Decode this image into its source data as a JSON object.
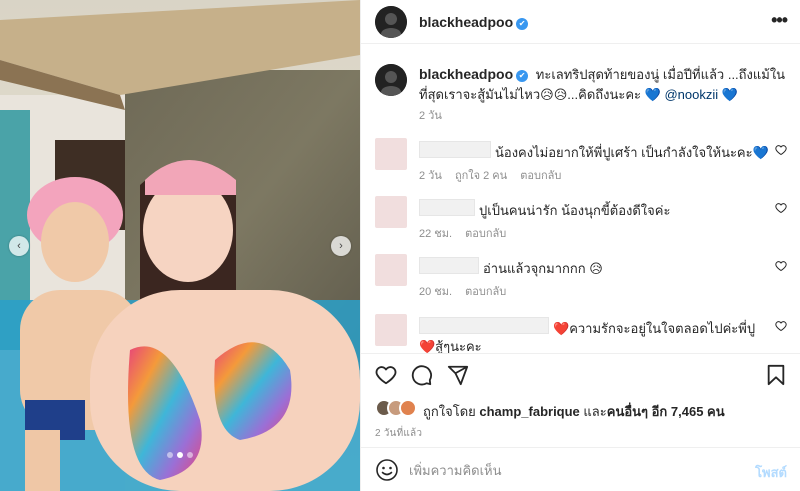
{
  "header": {
    "username": "blackheadpoo",
    "verified_mark": "✔",
    "more_icon": "more-horizontal-icon"
  },
  "caption": {
    "username": "blackheadpoo",
    "text": "ทะเลทริปสุดท้ายของนู่ เมื่อปีที่แล้ว ...ถึงแม้ในที่สุดเราจะสู้มันไม่ไหว😥😥...คิดถึงนะคะ",
    "heart1": "💙",
    "mention": "@nookzii",
    "heart2": "💙",
    "time": "2 วัน"
  },
  "comments": [
    {
      "text": "น้องคงไม่อยากให้พี่ปูเศร้า เป็นกำลังใจให้นะคะ💙",
      "time": "2 วัน",
      "likes": "ถูกใจ 2 คน",
      "reply": "ตอบกลับ"
    },
    {
      "text": "ปูเป็นคนน่ารัก น้องนุกขี้ต้องดีใจค่ะ",
      "time": "22 ชม.",
      "reply": "ตอบกลับ"
    },
    {
      "text": "อ่านแล้วจุกมากกก 😥",
      "time": "20 ชม.",
      "reply": "ตอบกลับ"
    },
    {
      "prefix": "❤️",
      "text": "ความรักจะอยู่ในใจตลอดไปค่ะพี่ปู",
      "second_line": "❤️สู้ๆนะคะ"
    }
  ],
  "actions": {
    "like_icon": "heart-icon",
    "comment_icon": "comment-icon",
    "share_icon": "share-icon",
    "save_icon": "bookmark-icon"
  },
  "likes": {
    "prefix": "ถูกใจโดย",
    "user": "champ_fabrique",
    "joiner": "และ",
    "others_label": "คนอื่นๆ อีก 7,465 คน"
  },
  "post_date": "2 วันที่แล้ว",
  "add_comment": {
    "placeholder": "เพิ่มความคิดเห็น",
    "post_label": "โพสต์",
    "emoji_icon": "emoji-icon"
  },
  "carousel": {
    "prev_glyph": "‹",
    "next_glyph": "›",
    "total_slides": 3,
    "active_slide": 2
  },
  "colors": {
    "accent_blue": "#3897f0",
    "post_button_disabled": "#b3dbff",
    "mention": "#00376b",
    "muted": "#8e8e8e"
  }
}
